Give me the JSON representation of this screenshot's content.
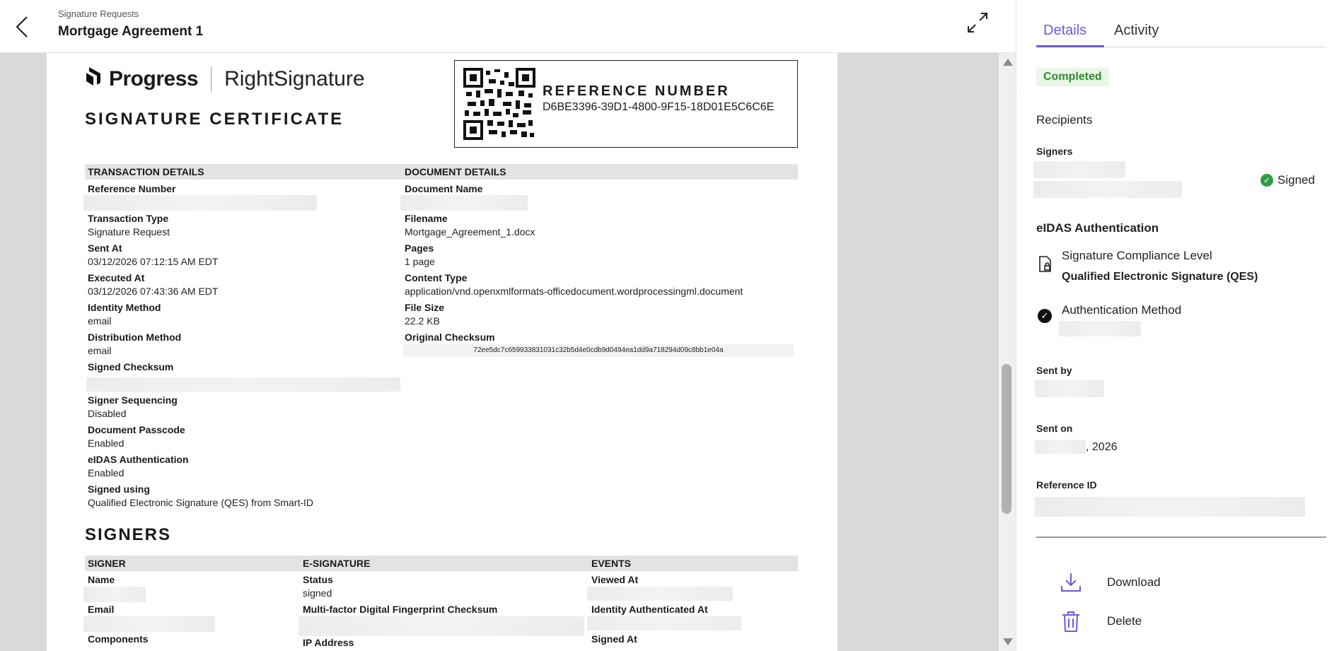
{
  "header": {
    "breadcrumb": "Signature Requests",
    "title": "Mortgage Agreement 1"
  },
  "certificate": {
    "logo_brand": "Progress",
    "logo_product": "RightSignature",
    "heading": "SIGNATURE CERTIFICATE",
    "reference_heading": "REFERENCE NUMBER",
    "reference_value": "D6BE3396-39D1-4800-9F15-18D01E5C6C6E",
    "transaction_header": "TRANSACTION DETAILS",
    "document_header": "DOCUMENT DETAILS",
    "transaction": {
      "reference_number_label": "Reference Number",
      "transaction_type_label": "Transaction Type",
      "transaction_type_value": "Signature Request",
      "sent_at_label": "Sent At",
      "sent_at_value": "03/12/2026 07:12:15 AM EDT",
      "executed_at_label": "Executed At",
      "executed_at_value": "03/12/2026 07:43:36 AM EDT",
      "identity_method_label": "Identity Method",
      "identity_method_value": "email",
      "distribution_method_label": "Distribution Method",
      "distribution_method_value": "email",
      "signed_checksum_label": "Signed Checksum",
      "signer_sequencing_label": "Signer Sequencing",
      "signer_sequencing_value": "Disabled",
      "document_passcode_label": "Document Passcode",
      "document_passcode_value": "Enabled",
      "eidas_label": "eIDAS Authentication",
      "eidas_value": "Enabled",
      "signed_using_label": "Signed using",
      "signed_using_value": "Qualified Electronic Signature (QES) from Smart-ID"
    },
    "document": {
      "document_name_label": "Document Name",
      "filename_label": "Filename",
      "filename_value": "Mortgage_Agreement_1.docx",
      "pages_label": "Pages",
      "pages_value": "1 page",
      "content_type_label": "Content Type",
      "content_type_value": "application/vnd.openxmlformats-officedocument.wordprocessingml.document",
      "file_size_label": "File Size",
      "file_size_value": "22.2 KB",
      "original_checksum_label": "Original Checksum",
      "original_checksum_value": "72ee5dc7c659933831031c32b5d4e0cdb9d0494ea1dd9a718294d09c8bb1e04a"
    },
    "signers_heading": "SIGNERS",
    "signers_table": {
      "col_signer": "SIGNER",
      "col_esignature": "E-SIGNATURE",
      "col_events": "EVENTS",
      "name_label": "Name",
      "email_label": "Email",
      "components_label": "Components",
      "status_label": "Status",
      "status_value": "signed",
      "fingerprint_label": "Multi-factor Digital Fingerprint Checksum",
      "ip_label": "IP Address",
      "viewed_at_label": "Viewed At",
      "identity_auth_label": "Identity Authenticated At",
      "signed_at_label": "Signed At"
    }
  },
  "sidebar": {
    "tabs": [
      "Details",
      "Activity"
    ],
    "status_badge": "Completed",
    "recipients_heading": "Recipients",
    "signers_label": "Signers",
    "signed_status": "Signed",
    "eidas_heading": "eIDAS Authentication",
    "compliance_label": "Signature Compliance Level",
    "compliance_value": "Qualified Electronic Signature (QES)",
    "auth_method_label": "Authentication Method",
    "sent_by_label": "Sent by",
    "sent_on_label": "Sent on",
    "sent_on_value": ", 2026",
    "reference_id_label": "Reference ID",
    "download_label": "Download",
    "delete_label": "Delete"
  },
  "colors": {
    "accent": "#6b5be0",
    "success": "#2e9e45",
    "badge_bg": "#eaf6e8"
  }
}
